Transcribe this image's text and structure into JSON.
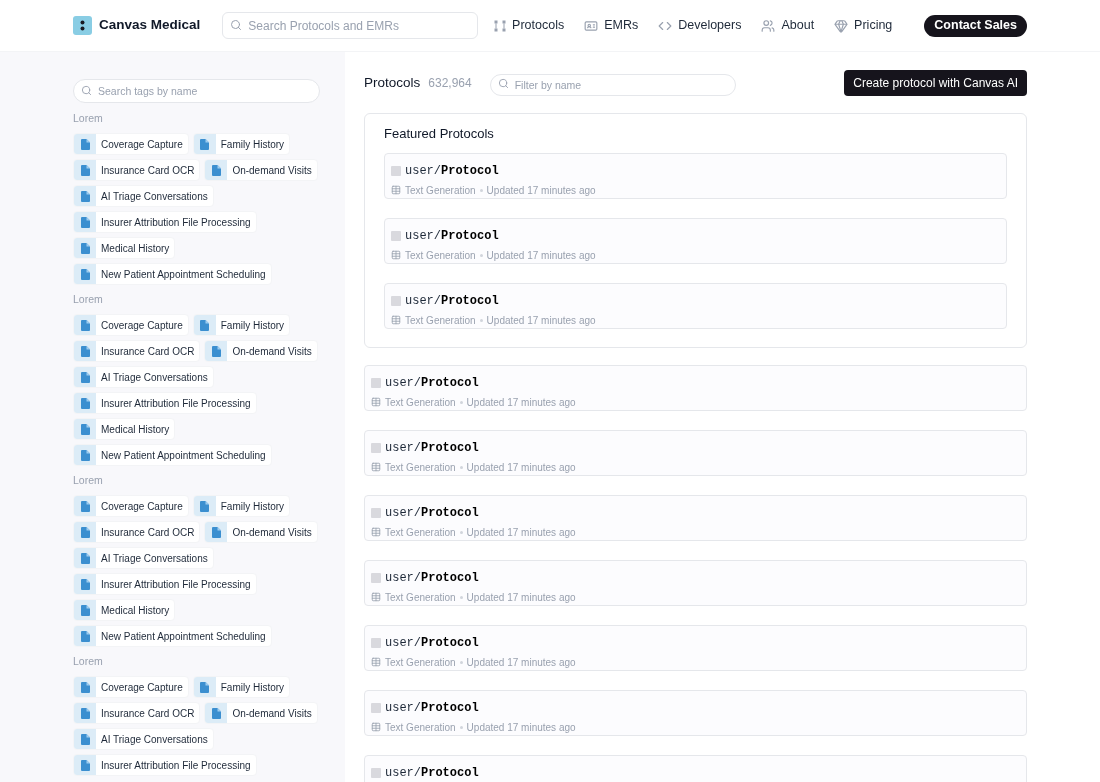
{
  "header": {
    "brand": "Canvas Medical",
    "search": {
      "placeholder": "Search Protocols and EMRs"
    },
    "nav": [
      {
        "label": "Protocols",
        "kind": "protocols"
      },
      {
        "label": "EMRs",
        "kind": "emrs"
      },
      {
        "label": "Developers",
        "kind": "developers"
      },
      {
        "label": "About",
        "kind": "about"
      },
      {
        "label": "Pricing",
        "kind": "pricing"
      }
    ],
    "cta": "Contact Sales"
  },
  "sidebar": {
    "search": {
      "placeholder": "Search tags by name"
    },
    "groups": [
      {
        "title": "Lorem",
        "tags": [
          "Coverage Capture",
          "Family History",
          "Insurance Card OCR",
          "On-demand Visits",
          "AI Triage Conversations",
          "Insurer Attribution File Processing",
          "Medical History",
          "New Patient Appointment Scheduling"
        ]
      },
      {
        "title": "Lorem",
        "tags": [
          "Coverage Capture",
          "Family History",
          "Insurance Card OCR",
          "On-demand Visits",
          "AI Triage Conversations",
          "Insurer Attribution File Processing",
          "Medical History",
          "New Patient Appointment Scheduling"
        ]
      },
      {
        "title": "Lorem",
        "tags": [
          "Coverage Capture",
          "Family History",
          "Insurance Card OCR",
          "On-demand Visits",
          "AI Triage Conversations",
          "Insurer Attribution File Processing",
          "Medical History",
          "New Patient Appointment Scheduling"
        ]
      },
      {
        "title": "Lorem",
        "tags": [
          "Coverage Capture",
          "Family History",
          "Insurance Card OCR",
          "On-demand Visits",
          "AI Triage Conversations",
          "Insurer Attribution File Processing"
        ]
      }
    ]
  },
  "main": {
    "title": "Protocols",
    "count": "632,964",
    "filter": {
      "placeholder": "Filter by name"
    },
    "create_button": "Create protocol with Canvas AI",
    "featured": {
      "title": "Featured Protocols",
      "items": [
        {
          "owner": "user/",
          "name": "Protocol",
          "category": "Text Generation",
          "updated": "Updated 17 minutes ago"
        },
        {
          "owner": "user/",
          "name": "Protocol",
          "category": "Text Generation",
          "updated": "Updated 17 minutes ago"
        },
        {
          "owner": "user/",
          "name": "Protocol",
          "category": "Text Generation",
          "updated": "Updated 17 minutes ago"
        }
      ]
    },
    "items": [
      {
        "owner": "user/",
        "name": "Protocol",
        "category": "Text Generation",
        "updated": "Updated 17 minutes ago"
      },
      {
        "owner": "user/",
        "name": "Protocol",
        "category": "Text Generation",
        "updated": "Updated 17 minutes ago"
      },
      {
        "owner": "user/",
        "name": "Protocol",
        "category": "Text Generation",
        "updated": "Updated 17 minutes ago"
      },
      {
        "owner": "user/",
        "name": "Protocol",
        "category": "Text Generation",
        "updated": "Updated 17 minutes ago"
      },
      {
        "owner": "user/",
        "name": "Protocol",
        "category": "Text Generation",
        "updated": "Updated 17 minutes ago"
      },
      {
        "owner": "user/",
        "name": "Protocol",
        "category": "Text Generation",
        "updated": "Updated 17 minutes ago"
      },
      {
        "owner": "user/",
        "name": "Protocol"
      }
    ]
  }
}
